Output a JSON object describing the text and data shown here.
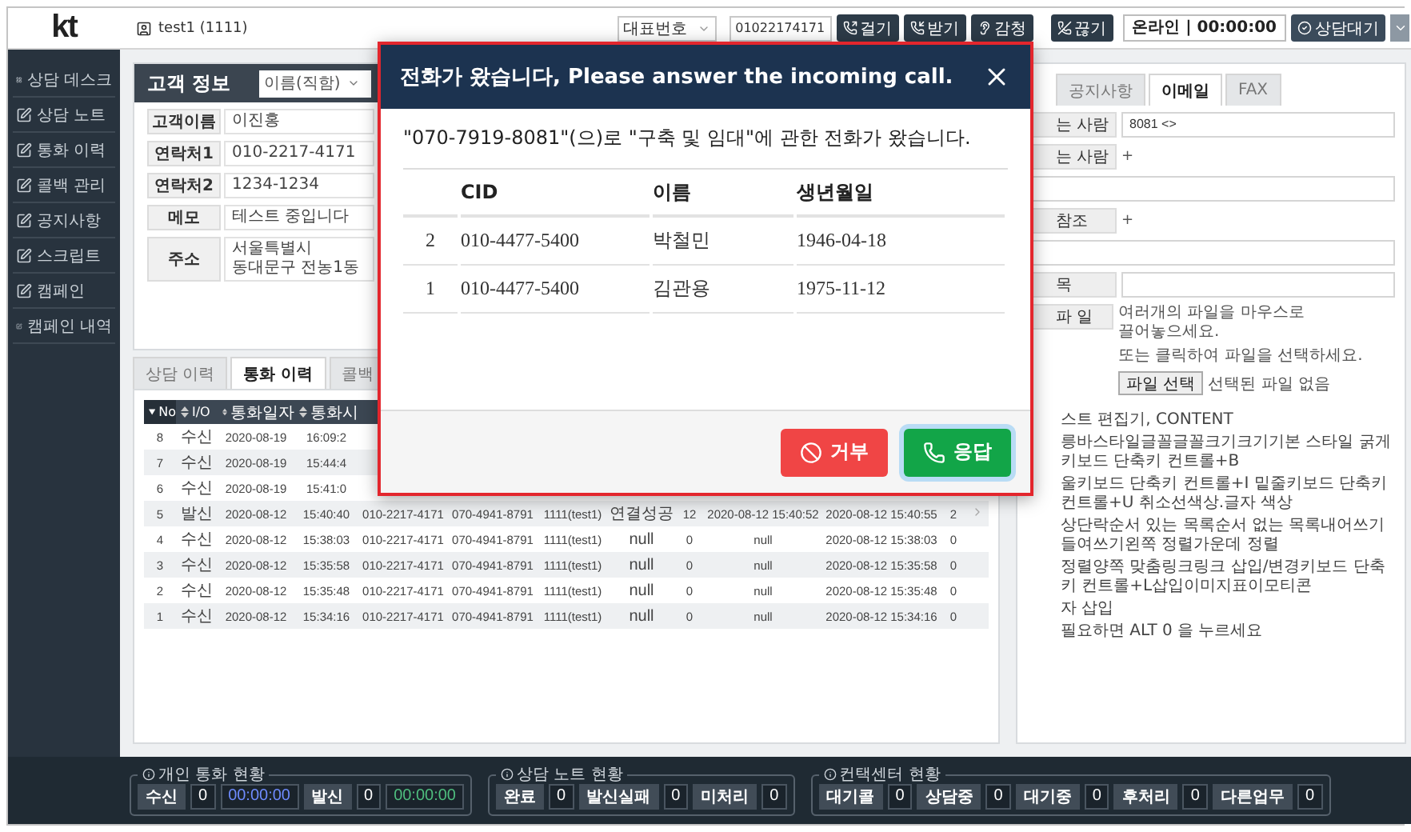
{
  "header": {
    "logo": "kt",
    "user": "test1 (1111)",
    "line_select": "대표번호",
    "phone": "01022174171",
    "call_buttons": [
      "걸기",
      "받기",
      "감청"
    ],
    "hangup": "끊기",
    "status": "온라인 | 00:00:00",
    "state_button": "상담대기"
  },
  "sidebar": {
    "items": [
      "상담 데스크",
      "상담 노트",
      "통화 이력",
      "콜백 관리",
      "공지사항",
      "스크립트",
      "캠페인",
      "캠페인 내역"
    ]
  },
  "customer": {
    "title": "고객 정보",
    "search_by": "이름(직함)",
    "fields": [
      {
        "label": "고객이름",
        "value": "이진홍"
      },
      {
        "label": "연락처1",
        "value": "010-2217-4171"
      },
      {
        "label": "연락처2",
        "value": "1234-1234"
      },
      {
        "label": "메모",
        "value": "테스트 중입니다"
      },
      {
        "label": "주소",
        "value": "서울특별시 동대문구 전농1동"
      }
    ]
  },
  "history": {
    "tabs": [
      {
        "label": "상담 이력",
        "selected": false
      },
      {
        "label": "통화 이력",
        "selected": true
      },
      {
        "label": "콜백",
        "selected": false
      }
    ],
    "columns": [
      {
        "label": "No",
        "sorted": true
      },
      {
        "label": "I/O",
        "sorted": false
      },
      {
        "label": "통화일자",
        "sorted": false
      },
      {
        "label": "통화시",
        "sorted": false
      }
    ],
    "rows": [
      {
        "cells": [
          "8",
          "수신",
          "2020-08-19",
          "16:09:2"
        ],
        "expandable": false
      },
      {
        "cells": [
          "7",
          "수신",
          "2020-08-19",
          "15:44:4"
        ],
        "expandable": false
      },
      {
        "cells": [
          "6",
          "수신",
          "2020-08-19",
          "15:41:0"
        ],
        "expandable": false
      },
      {
        "cells": [
          "5",
          "발신",
          "2020-08-12",
          "15:40:40",
          "010-2217-4171",
          "070-4941-8791",
          "1111(test1)",
          "연결성공",
          "12",
          "2020-08-12 15:40:52",
          "2020-08-12 15:40:55",
          "2"
        ],
        "expandable": true
      },
      {
        "cells": [
          "4",
          "수신",
          "2020-08-12",
          "15:38:03",
          "010-2217-4171",
          "070-4941-8791",
          "1111(test1)",
          "null",
          "0",
          "null",
          "2020-08-12 15:38:03",
          "0"
        ],
        "expandable": false
      },
      {
        "cells": [
          "3",
          "수신",
          "2020-08-12",
          "15:35:58",
          "010-2217-4171",
          "070-4941-8791",
          "1111(test1)",
          "null",
          "0",
          "null",
          "2020-08-12 15:35:58",
          "0"
        ],
        "expandable": false
      },
      {
        "cells": [
          "2",
          "수신",
          "2020-08-12",
          "15:35:48",
          "010-2217-4171",
          "070-4941-8791",
          "1111(test1)",
          "null",
          "0",
          "null",
          "2020-08-12 15:35:48",
          "0"
        ],
        "expandable": false
      },
      {
        "cells": [
          "1",
          "수신",
          "2020-08-12",
          "15:34:16",
          "010-2217-4171",
          "070-4941-8791",
          "1111(test1)",
          "null",
          "0",
          "null",
          "2020-08-12 15:34:16",
          "0"
        ],
        "expandable": false
      }
    ]
  },
  "email": {
    "tabs": [
      {
        "label": "공지사항",
        "selected": false
      },
      {
        "label": "이메일",
        "selected": true
      },
      {
        "label": "FAX",
        "selected": false
      }
    ],
    "from": {
      "label": "는 사람",
      "value": "8081 <>"
    },
    "recipients": [
      {
        "label": "는 사람",
        "add": "+"
      },
      {
        "label": "참조",
        "add": "+"
      }
    ],
    "subject": {
      "label": "목"
    },
    "attachment": {
      "label": "파 일",
      "hints": [
        "여러개의 파일을 마우스로 끌어놓으세요.",
        "또는 클릭하여 파일을 선택하세요."
      ],
      "button": "파일 선택",
      "status": "선택된 파일 없음"
    },
    "editor_lines": [
      "스트 편집기, CONTENT",
      "릉바스타일글꼴글꼴크기크기기본 스타일 굵게키보드 단축키 컨트롤+B",
      "울키보드 단축키 컨트롤+I 밑줄키보드 단축키 컨트롤+U 취소선색상.글자 색상",
      "상단락순서 있는 목록순서 없는 목록내어쓰기들여쓰기왼쪽 정렬가운데 정렬",
      "정렬양쪽 맞춤링크링크 삽입/변경키보드 단축키 컨트롤+L삽입이미지표이모티콘",
      "자 삽입",
      "필요하면 ALT 0 을 누르세요"
    ]
  },
  "status_bar": {
    "groups": [
      {
        "title": "개인 통화 현황",
        "items": [
          {
            "kind": "label",
            "text": "수신"
          },
          {
            "kind": "count",
            "text": "0"
          },
          {
            "kind": "timer",
            "text": "00:00:00",
            "color": "#6f8cff"
          },
          {
            "kind": "label",
            "text": "발신"
          },
          {
            "kind": "count",
            "text": "0"
          },
          {
            "kind": "timer",
            "text": "00:00:00",
            "color": "#4fbf7f"
          }
        ]
      },
      {
        "title": "상담 노트 현황",
        "items": [
          {
            "kind": "label",
            "text": "완료"
          },
          {
            "kind": "count",
            "text": "0"
          },
          {
            "kind": "label",
            "text": "발신실패"
          },
          {
            "kind": "count",
            "text": "0"
          },
          {
            "kind": "label",
            "text": "미처리"
          },
          {
            "kind": "count",
            "text": "0"
          }
        ]
      },
      {
        "title": "컨택센터 현황",
        "items": [
          {
            "kind": "label",
            "text": "대기콜"
          },
          {
            "kind": "count",
            "text": "0"
          },
          {
            "kind": "label",
            "text": "상담중"
          },
          {
            "kind": "count",
            "text": "0"
          },
          {
            "kind": "label",
            "text": "대기중"
          },
          {
            "kind": "count",
            "text": "0"
          },
          {
            "kind": "label",
            "text": "후처리"
          },
          {
            "kind": "count",
            "text": "0"
          },
          {
            "kind": "label",
            "text": "다른업무"
          },
          {
            "kind": "count",
            "text": "0"
          }
        ]
      }
    ]
  },
  "modal": {
    "title": "전화가 왔습니다, Please answer the incoming call.",
    "message": "\"070-7919-8081\"(으)로 \"구축 및 임대\"에 관한 전화가 왔습니다.",
    "columns": [
      "CID",
      "이름",
      "생년월일"
    ],
    "rows": [
      {
        "no": "2",
        "cid": "010-4477-5400",
        "name": "박철민",
        "birth": "1946-04-18"
      },
      {
        "no": "1",
        "cid": "010-4477-5400",
        "name": "김관용",
        "birth": "1975-11-12"
      }
    ],
    "buttons": [
      {
        "kind": "reject",
        "label": "거부"
      },
      {
        "kind": "accept",
        "label": "응답"
      }
    ]
  }
}
